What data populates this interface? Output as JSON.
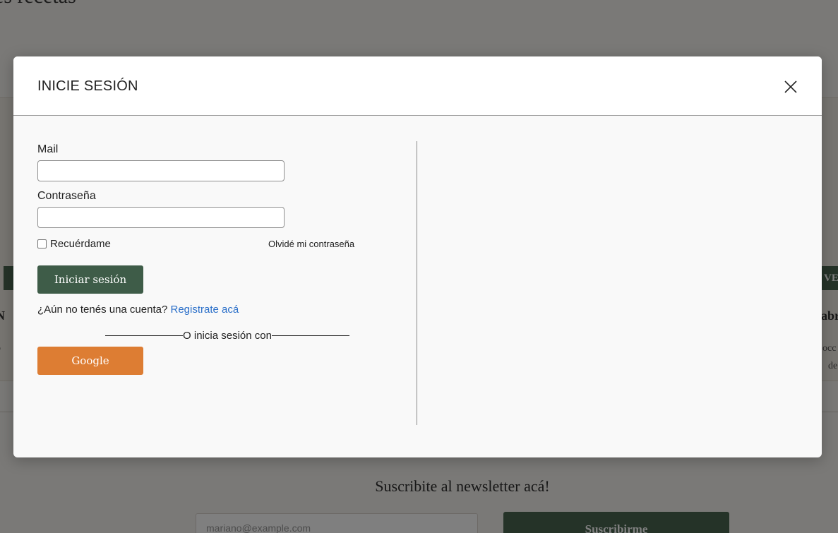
{
  "background": {
    "heading": "es recetas",
    "left_card": {
      "button": "",
      "title": "N",
      "text": [
        "z o"
      ]
    },
    "right_card": {
      "button": "VE",
      "title": "abr",
      "text": [
        "occ",
        "de"
      ]
    },
    "newsletter": {
      "prompt": "Suscribite al newsletter acá!",
      "email_placeholder": "mariano@example.com",
      "subscribe_label": "Suscribirme"
    }
  },
  "modal": {
    "title": "INICIE SESIÓN",
    "close_icon": "close-icon",
    "form": {
      "mail_label": "Mail",
      "mail_value": "",
      "password_label": "Contraseña",
      "password_value": "",
      "remember_label": "Recuérdame",
      "remember_checked": false,
      "forgot_label": "Olvidé mi contraseña",
      "login_button": "Iniciar sesión",
      "no_account_text": "¿Aún no tenés una cuenta?",
      "register_link": "Registrate acá",
      "social_divider": "O inicia sesión con",
      "google_button": "Google"
    }
  },
  "colors": {
    "primary_green": "#3e5c48",
    "google_orange": "#dd7d33",
    "link_blue": "#2a6fc9",
    "overlay": "rgba(0,0,0,0.5)"
  }
}
